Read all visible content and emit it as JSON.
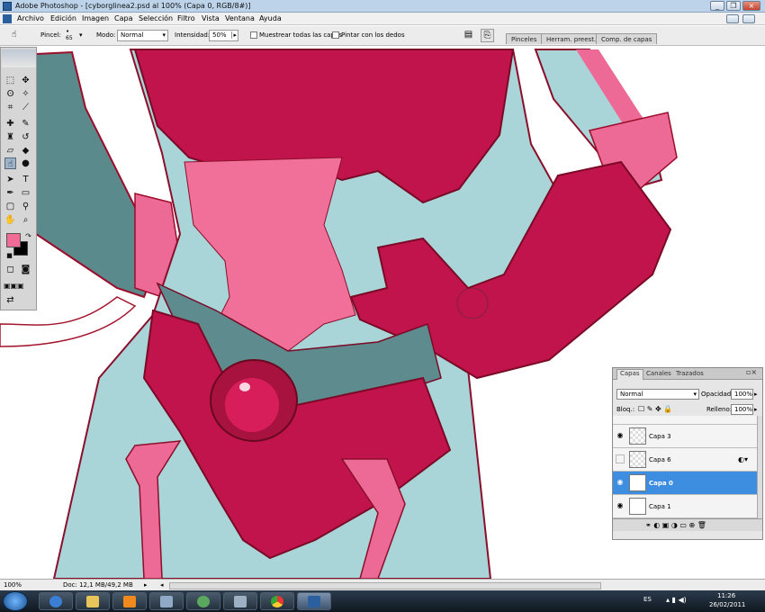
{
  "window": {
    "title": "Adobe Photoshop - [cyborglinea2.psd al 100% (Capa 0, RGB/8#)]",
    "buttons": [
      "_",
      "❐",
      "×"
    ]
  },
  "menu": {
    "items": [
      "Archivo",
      "Edición",
      "Imagen",
      "Capa",
      "Selección",
      "Filtro",
      "Vista",
      "Ventana",
      "Ayuda"
    ]
  },
  "options": {
    "brush_label": "Pincel:",
    "brush_size": "65",
    "mode_label": "Modo:",
    "mode_value": "Normal",
    "intensity_label": "Intensidad:",
    "intensity_value": "50%",
    "sample_all_label": "Muestrear todas las capas",
    "finger_label": "Pintar con los dedos",
    "palette_tabs": [
      "Pinceles",
      "Herram. preest.",
      "Comp. de capas"
    ]
  },
  "layers_panel": {
    "tabs": [
      "Capas",
      "Canales",
      "Trazados"
    ],
    "blend_mode": "Normal",
    "opacity_label": "Opacidad:",
    "opacity_value": "100%",
    "lock_label": "Bloq.:",
    "fill_label": "Relleno:",
    "fill_value": "100%",
    "rows": [
      {
        "name": "Capa 3",
        "visible": true,
        "selected": false
      },
      {
        "name": "Capa 6",
        "visible": false,
        "selected": false
      },
      {
        "name": "Capa 0",
        "visible": true,
        "selected": true
      },
      {
        "name": "Capa 1",
        "visible": true,
        "selected": false
      }
    ]
  },
  "status": {
    "zoom": "100%",
    "doc": "Doc: 12,1 MB/49,2 MB"
  },
  "taskbar": {
    "lang": "ES",
    "time": "11:26",
    "date": "26/02/2011"
  },
  "colors": {
    "foreground": "#f06c96",
    "background": "#000000",
    "selection": "#3d8ee0"
  }
}
